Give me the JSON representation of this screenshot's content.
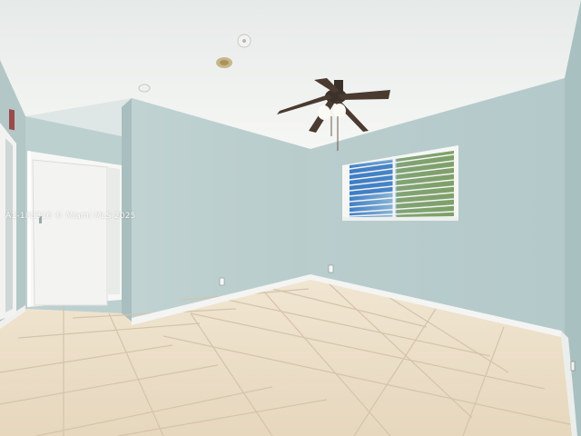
{
  "scene": {
    "description_type": "photo",
    "watermark_text": "A1-188316 © Miami MLS 2025"
  },
  "colors": {
    "ceiling": "#eef1ef",
    "wall_left": "#bccfcf",
    "wall_back": "#b8cdce",
    "wall_right": "#b3c9ca",
    "floor": "#e9dcc6",
    "grout": "#cfc0a6",
    "baseboard": "#f4f4f2",
    "door": "#f5f5f3"
  },
  "icons": [
    "ceiling-fan-icon",
    "smoke-detector-icon",
    "window-blinds-icon",
    "door-icon",
    "outlet-icon"
  ]
}
